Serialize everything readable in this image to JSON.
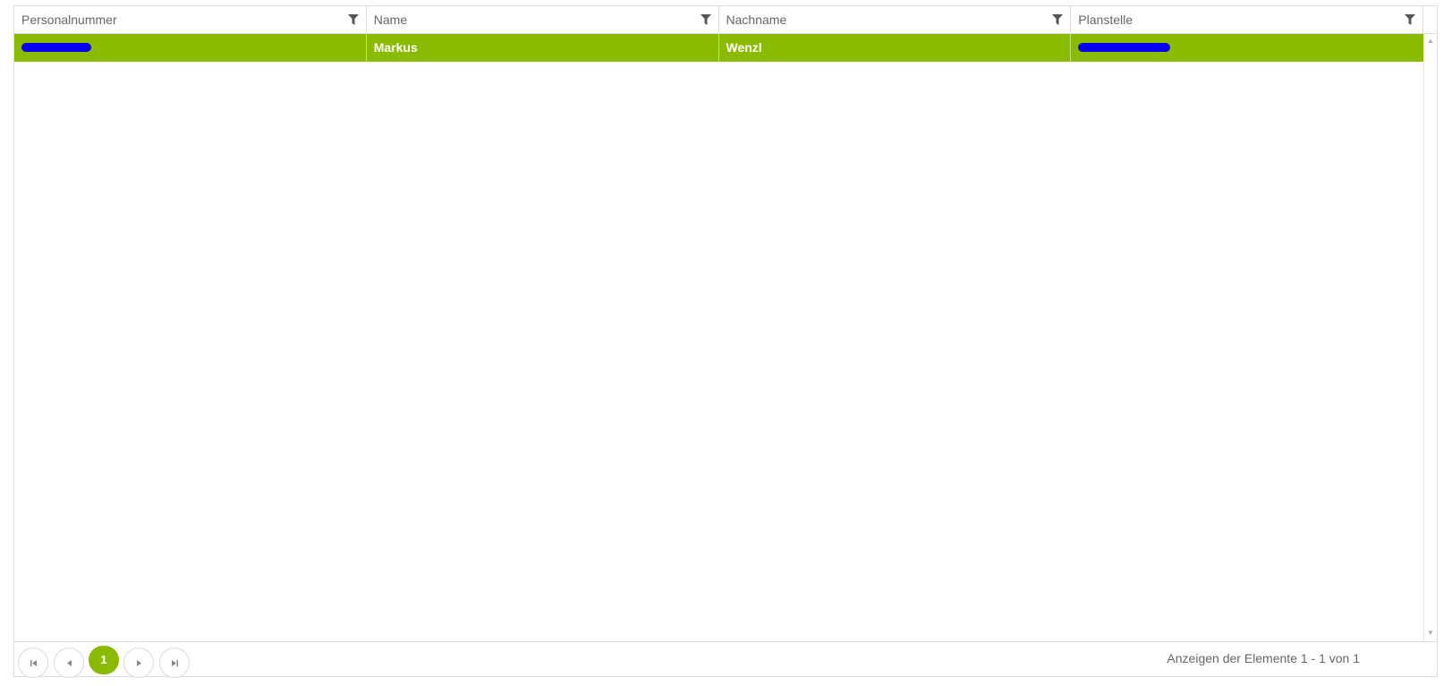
{
  "grid": {
    "columns": [
      {
        "label": "Personalnummer"
      },
      {
        "label": "Name"
      },
      {
        "label": "Nachname"
      },
      {
        "label": "Planstelle"
      }
    ],
    "rows": [
      {
        "personalnummer": "",
        "name": "Markus",
        "nachname": "Wenzl",
        "planstelle": ""
      }
    ],
    "selected_row_color": "#8bbb00",
    "redaction_color": "#0a00f0"
  },
  "pager": {
    "first_icon": "first-page-icon",
    "prev_icon": "previous-page-icon",
    "current_page": "1",
    "next_icon": "next-page-icon",
    "last_icon": "last-page-icon",
    "info": "Anzeigen der Elemente 1 - 1 von 1"
  }
}
